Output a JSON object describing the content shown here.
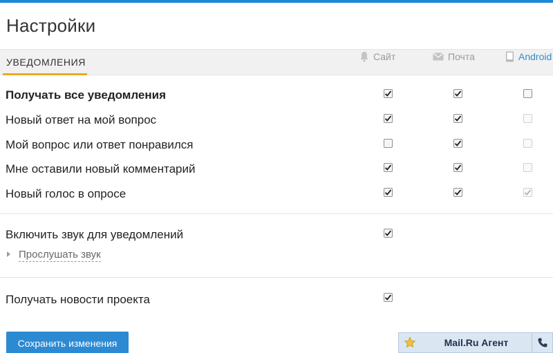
{
  "page": {
    "title": "Настройки"
  },
  "section": {
    "tab_label": "УВЕДОМЛЕНИЯ"
  },
  "columns": [
    {
      "key": "site",
      "label": "Сайт",
      "icon": "bell-icon"
    },
    {
      "key": "mail",
      "label": "Почта",
      "icon": "envelope-icon"
    },
    {
      "key": "android",
      "label": "Android",
      "icon": "android-device-icon"
    }
  ],
  "notifications": [
    {
      "label": "Получать все уведомления",
      "bold": true,
      "site": true,
      "mail": true,
      "android": false,
      "android_disabled": false
    },
    {
      "label": "Новый ответ на мой вопрос",
      "bold": false,
      "site": true,
      "mail": true,
      "android": false,
      "android_disabled": true
    },
    {
      "label": "Мой вопрос или ответ понравился",
      "bold": false,
      "site": false,
      "mail": true,
      "android": false,
      "android_disabled": true
    },
    {
      "label": "Мне оставили новый комментарий",
      "bold": false,
      "site": true,
      "mail": true,
      "android": false,
      "android_disabled": true
    },
    {
      "label": "Новый голос в опросе",
      "bold": false,
      "site": true,
      "mail": true,
      "android": true,
      "android_disabled": true
    }
  ],
  "sound": {
    "label": "Включить звук для уведомлений",
    "checked": true,
    "listen_label": "Прослушать звук"
  },
  "news": {
    "label": "Получать новости проекта",
    "checked": true
  },
  "actions": {
    "save_label": "Сохранить изменения"
  },
  "agent": {
    "title": "Mail.Ru Агент",
    "star_icon": "star-icon",
    "phone_icon": "phone-icon"
  },
  "colors": {
    "accent": "#2c8ad3",
    "tab_underline": "#f0a81c",
    "android_link": "#2f8cc9",
    "top_bar": "#1e88d8"
  }
}
